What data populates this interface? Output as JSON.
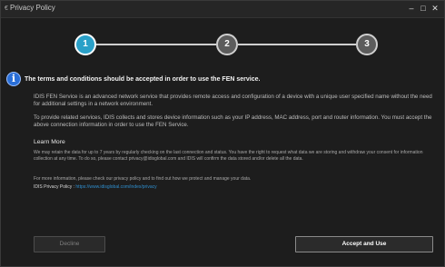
{
  "window": {
    "title": "Privacy Policy",
    "app_icon": "app-icon",
    "controls": {
      "minimize": "–",
      "maximize": "□",
      "close": "✕"
    }
  },
  "steps": [
    {
      "label": "1",
      "state": "active"
    },
    {
      "label": "2",
      "state": "inactive"
    },
    {
      "label": "3",
      "state": "inactive"
    }
  ],
  "colors": {
    "accent": "#2aa0c8",
    "link": "#2f8fcf",
    "info_icon": "#2a6fd8"
  },
  "content": {
    "info_icon_glyph": "i",
    "heading": "The terms and conditions should be accepted in order to use the FEN service.",
    "paragraph1": "IDIS FEN Service is an advanced network service that provides remote access and configuration of a device with a unique user specified name without the need for additional settings in a network environment.",
    "paragraph2": "To provide related services, IDIS collects and stores device information such as your IP address, MAC address, port and router information. You must accept the above connection information in order to use the FEN Service.",
    "learn_more_title": "Learn More",
    "learn_more_text": "We may retain the data for up to 7 years by regularly checking on the last connection and status. You have the right to request what data we are storing and withdraw your consent for information collection at any time. To do so, please contact privacy@idisglobal.com and IDIS will confirm the data stored and/or delete all the data.",
    "more_info_text": "For more information, please check our privacy policy and to find out how we protect and manage your data.",
    "policy_label": "IDIS Privacy Policy : ",
    "policy_url": "https://www.idisglobal.com/index/privacy"
  },
  "buttons": {
    "decline": "Decline",
    "accept": "Accept and Use"
  }
}
